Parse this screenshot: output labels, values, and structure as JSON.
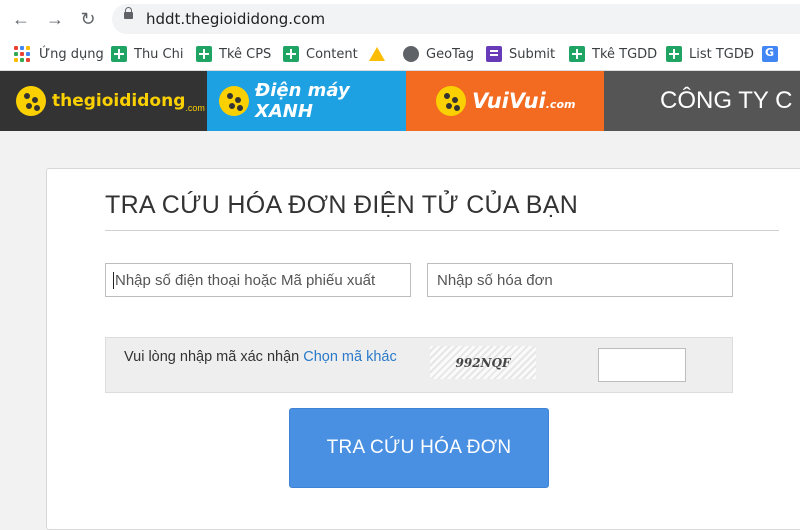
{
  "browser": {
    "url": "hddt.thegioididong.com",
    "bookmarks": [
      {
        "label": "Ứng dụng",
        "icon": "apps-grid-icon"
      },
      {
        "label": "Thu Chi",
        "icon": "google-sheets-icon"
      },
      {
        "label": "Tkê CPS",
        "icon": "google-sheets-icon"
      },
      {
        "label": "Content",
        "icon": "google-sheets-icon"
      },
      {
        "label": "",
        "icon": "google-drive-icon"
      },
      {
        "label": "GeoTag",
        "icon": "globe-icon"
      },
      {
        "label": "Submit",
        "icon": "google-forms-icon"
      },
      {
        "label": "Tkê TGDD",
        "icon": "google-sheets-icon"
      },
      {
        "label": "List TGDĐ",
        "icon": "google-sheets-icon"
      },
      {
        "label": "",
        "icon": "google-translate-icon"
      }
    ]
  },
  "banner": {
    "brands": [
      {
        "name": "thegioididong",
        "suffix": ".com",
        "color": "#333333"
      },
      {
        "name": "Điện máy XANH",
        "color": "#1da1e2"
      },
      {
        "name": "VuiVui",
        "suffix": ".com",
        "color": "#f26b21"
      },
      {
        "name": "CÔNG TY C",
        "color": "#555555"
      }
    ]
  },
  "form": {
    "title": "TRA CỨU HÓA ĐƠN ĐIỆN TỬ CỦA BẠN",
    "phone_placeholder": "Nhập số điện thoại hoặc Mã phiếu xuất",
    "invoice_placeholder": "Nhập số hóa đơn",
    "captcha_label": "Vui lòng nhập mã xác nhận",
    "captcha_change": "Chọn mã khác",
    "captcha_code": "992NQF",
    "submit_label": "TRA CỨU HÓA ĐƠN"
  }
}
